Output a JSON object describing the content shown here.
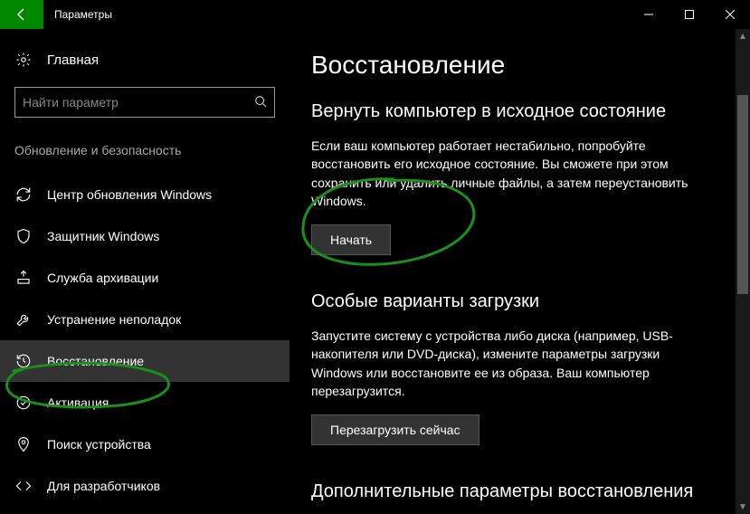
{
  "window": {
    "title": "Параметры"
  },
  "sidebar": {
    "home_label": "Главная",
    "search_placeholder": "Найти параметр",
    "category": "Обновление и безопасность",
    "items": [
      {
        "icon": "sync",
        "label": "Центр обновления Windows"
      },
      {
        "icon": "shield",
        "label": "Защитник Windows"
      },
      {
        "icon": "backup",
        "label": "Служба архивации"
      },
      {
        "icon": "troubleshoot",
        "label": "Устранение неполадок"
      },
      {
        "icon": "recovery",
        "label": "Восстановление"
      },
      {
        "icon": "activation",
        "label": "Активация"
      },
      {
        "icon": "finddevice",
        "label": "Поиск устройства"
      },
      {
        "icon": "developer",
        "label": "Для разработчиков"
      }
    ]
  },
  "main": {
    "title": "Восстановление",
    "section1": {
      "title": "Вернуть компьютер в исходное состояние",
      "desc": "Если ваш компьютер работает нестабильно, попробуйте восстановить его исходное состояние. Вы сможете при этом сохранить или удалить личные файлы, а затем переустановить Windows.",
      "button": "Начать"
    },
    "section2": {
      "title": "Особые варианты загрузки",
      "desc": "Запустите систему с устройства либо диска (например, USB-накопителя или DVD-диска), измените параметры загрузки Windows или восстановите ее из образа. Ваш компьютер перезагрузится.",
      "button": "Перезагрузить сейчас"
    },
    "section3": {
      "title": "Дополнительные параметры восстановления"
    }
  }
}
